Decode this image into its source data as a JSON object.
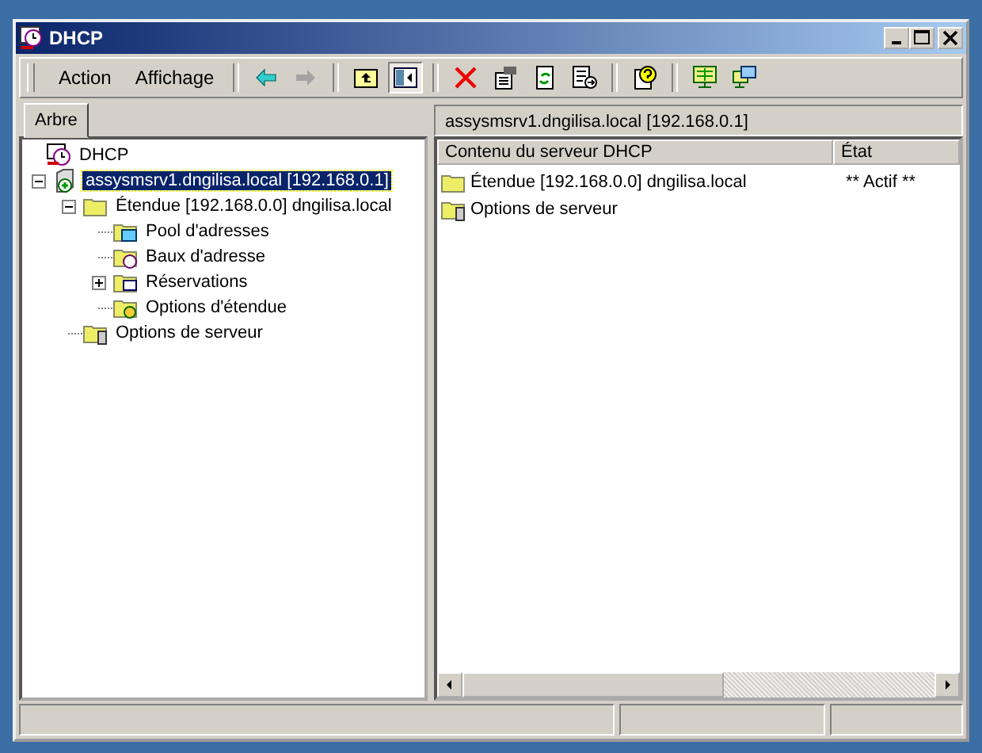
{
  "window": {
    "title": "DHCP"
  },
  "menu": [
    {
      "label": "Action"
    },
    {
      "label": "Affichage"
    }
  ],
  "toolbar": [
    {
      "kind": "back",
      "disabled": false,
      "pressed": false
    },
    {
      "kind": "forward",
      "disabled": true,
      "pressed": false
    },
    {
      "kind": "up",
      "disabled": false,
      "pressed": false
    },
    {
      "kind": "tree",
      "disabled": false,
      "pressed": true
    },
    {
      "kind": "delete",
      "disabled": false,
      "pressed": false
    },
    {
      "kind": "properties",
      "disabled": false,
      "pressed": false
    },
    {
      "kind": "refresh",
      "disabled": false,
      "pressed": false
    },
    {
      "kind": "export",
      "disabled": false,
      "pressed": false
    },
    {
      "kind": "help",
      "disabled": false,
      "pressed": false
    },
    {
      "kind": "monitor",
      "disabled": false,
      "pressed": false
    },
    {
      "kind": "monitors",
      "disabled": false,
      "pressed": false
    }
  ],
  "tabs": [
    {
      "label": "Arbre",
      "selected": true
    }
  ],
  "tree": [
    {
      "label": "DHCP",
      "kind": "dhcp",
      "selected": false,
      "children": [
        {
          "label": "assysmsrv1.dngilisa.local [192.168.0.1]",
          "kind": "server",
          "expanded": true,
          "selected": true,
          "children": [
            {
              "label": "Étendue [192.168.0.0] dngilisa.local",
              "kind": "folder",
              "expanded": true,
              "selected": false,
              "children": [
                {
                  "label": "Pool d'adresses",
                  "kind": "pool",
                  "selected": false
                },
                {
                  "label": "Baux d'adresse",
                  "kind": "leases",
                  "selected": false
                },
                {
                  "label": "Réservations",
                  "kind": "reservations",
                  "expanded": false,
                  "selected": false
                },
                {
                  "label": "Options d'étendue",
                  "kind": "options",
                  "selected": false
                }
              ]
            },
            {
              "label": "Options de serveur",
              "kind": "server-options",
              "selected": false
            }
          ]
        }
      ]
    }
  ],
  "details": {
    "path": "assysmsrv1.dngilisa.local [192.168.0.1]",
    "columns": [
      "Contenu du serveur DHCP",
      "État"
    ],
    "rows": [
      {
        "kind": "folder",
        "name": "Étendue [192.168.0.0] dngilisa.local",
        "state": "** Actif **"
      },
      {
        "kind": "server-options",
        "name": "Options de serveur"
      }
    ]
  }
}
